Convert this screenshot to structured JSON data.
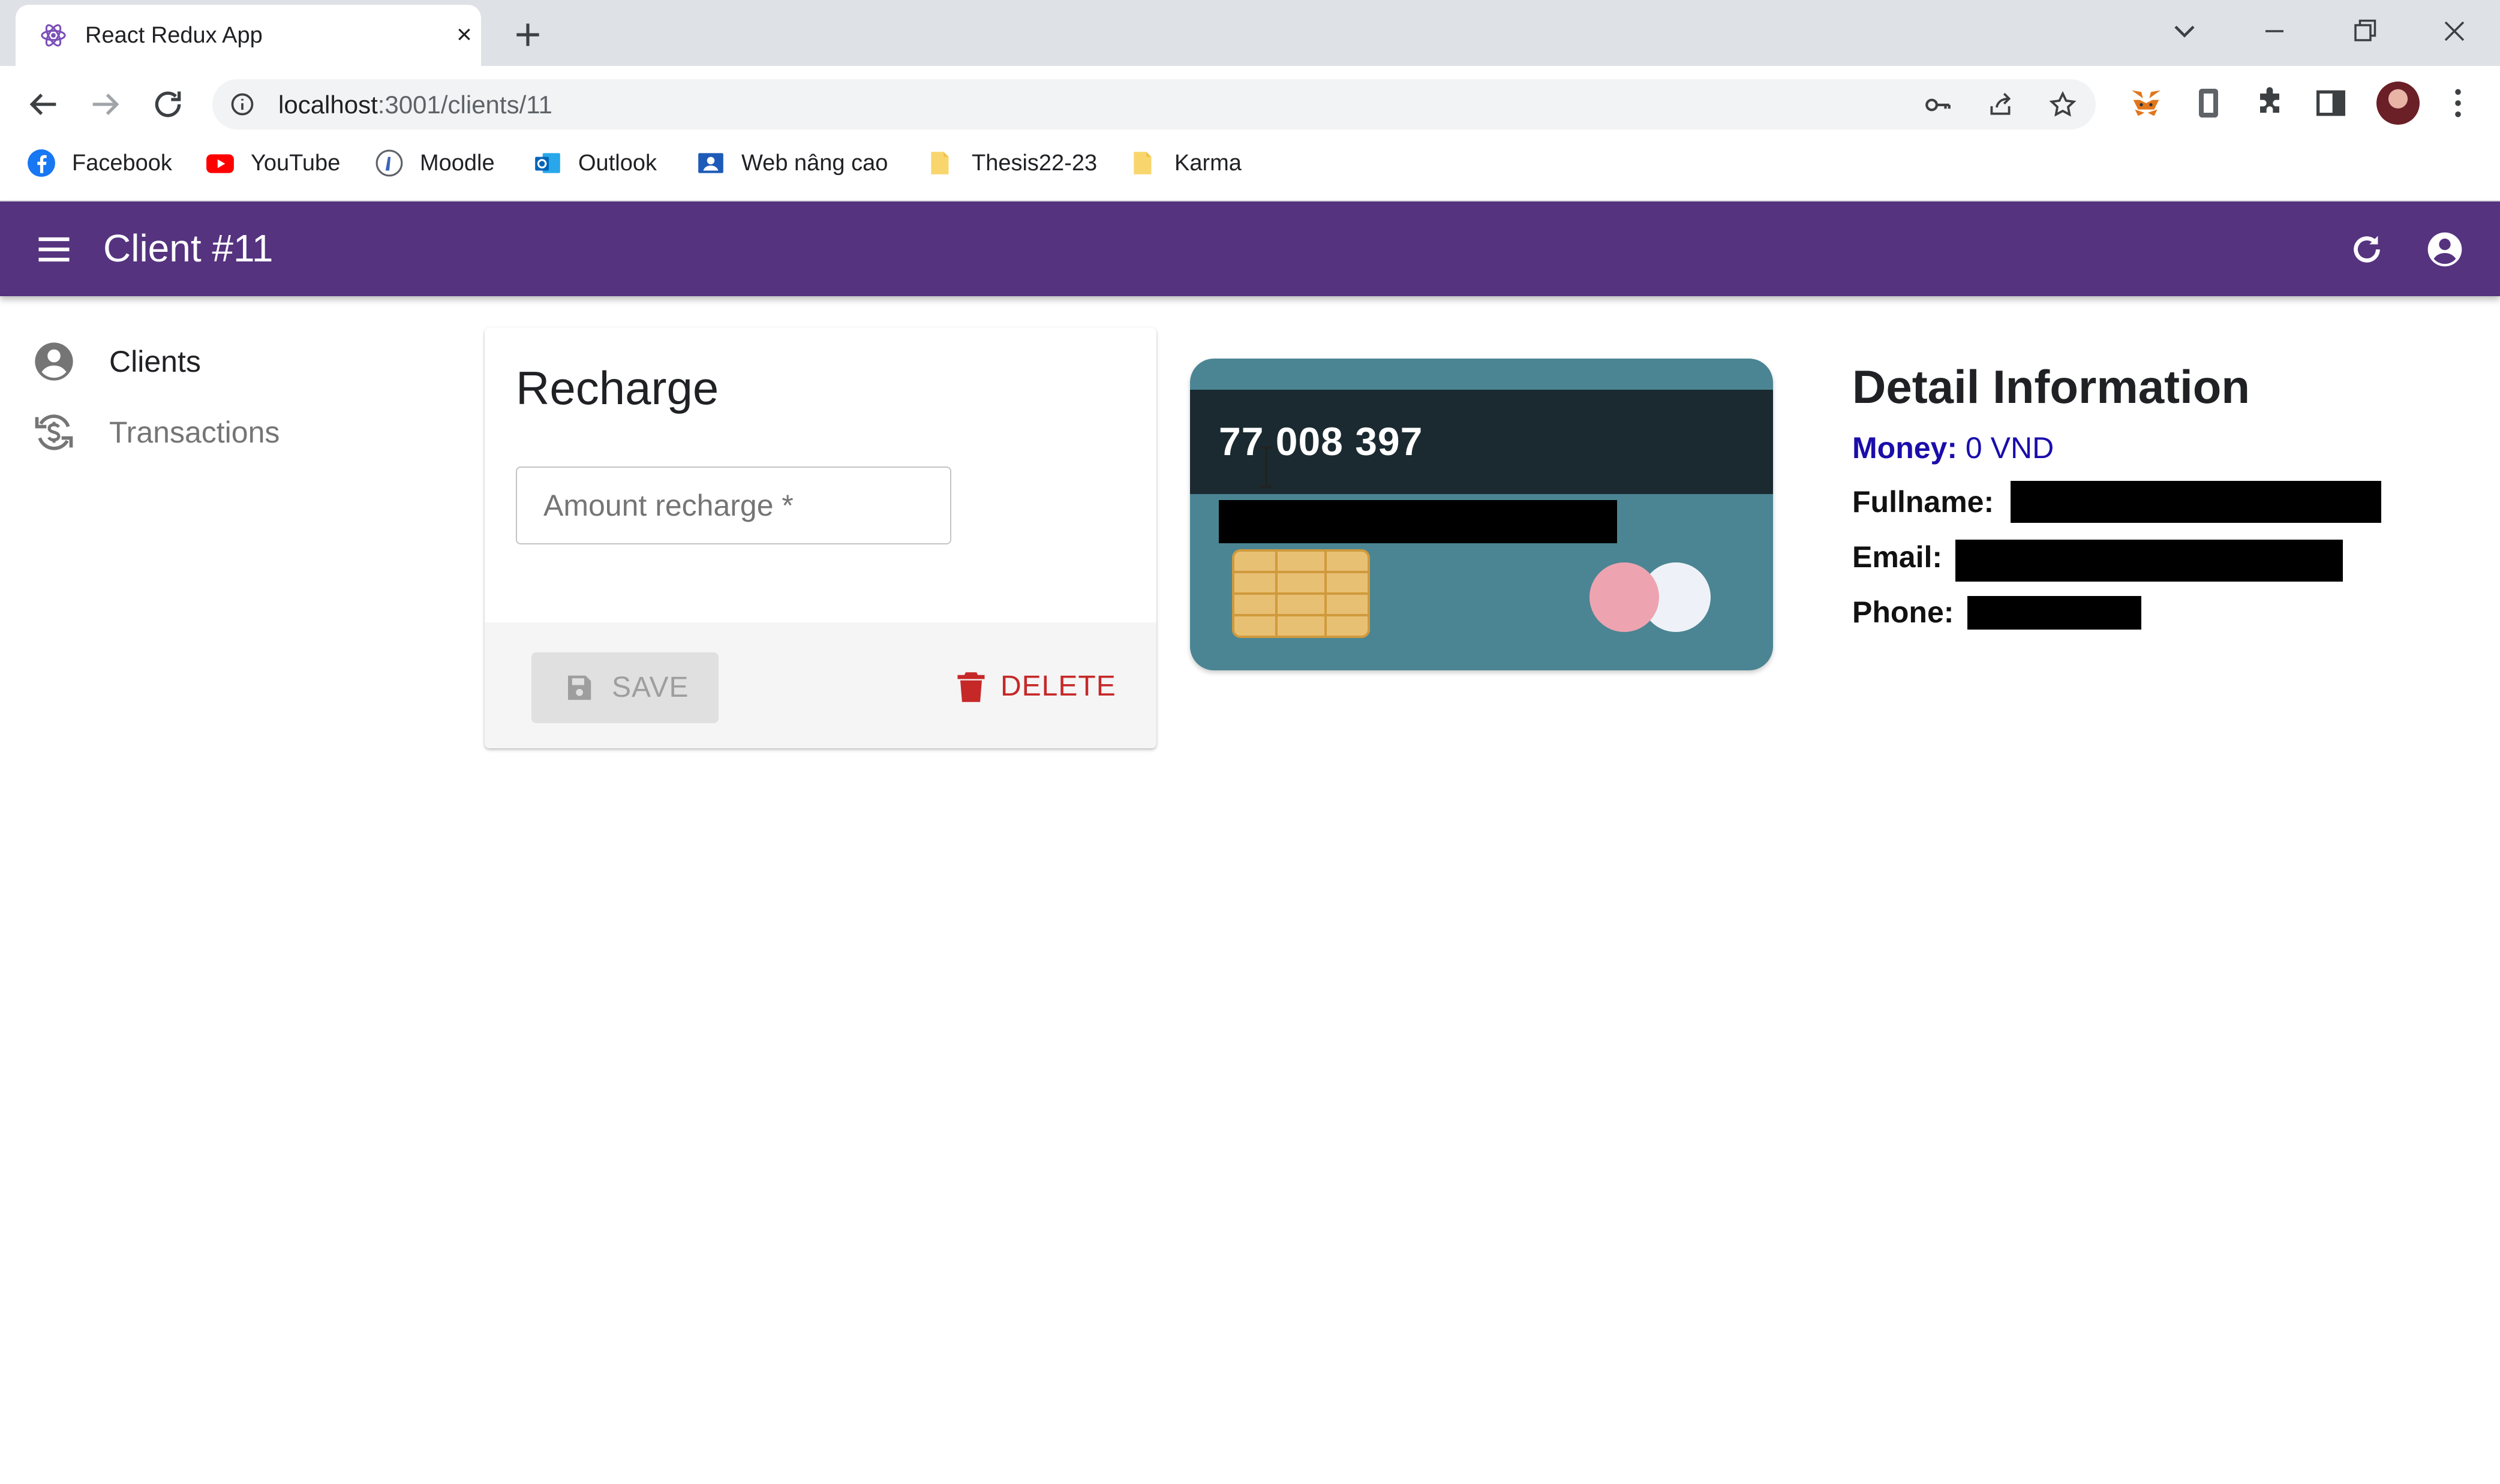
{
  "browser": {
    "tab_title": "React Redux App",
    "tab_close": "×",
    "url_host": "localhost",
    "url_rest": ":3001/clients/11",
    "bookmarks": [
      {
        "label": "Facebook",
        "icon": "facebook-icon"
      },
      {
        "label": "YouTube",
        "icon": "youtube-icon"
      },
      {
        "label": "Moodle",
        "icon": "moodle-icon"
      },
      {
        "label": "Outlook",
        "icon": "outlook-icon"
      },
      {
        "label": "Web nâng cao",
        "icon": "classroom-icon"
      },
      {
        "label": "Thesis22-23",
        "icon": "folder-icon"
      },
      {
        "label": "Karma",
        "icon": "folder-icon"
      }
    ]
  },
  "appbar": {
    "title": "Client #11",
    "color": "#55337f"
  },
  "sidebar": {
    "items": [
      {
        "label": "Clients",
        "icon": "account-circle-icon",
        "color": "#202124"
      },
      {
        "label": "Transactions",
        "icon": "currency-exchange-icon",
        "color": "#757575"
      }
    ]
  },
  "recharge": {
    "title": "Recharge",
    "amount_placeholder": "Amount recharge *",
    "amount_value": "",
    "save_label": "SAVE",
    "delete_label": "DELETE"
  },
  "credit_card": {
    "number": "77 008 397",
    "color": "#4b8593"
  },
  "detail": {
    "title": "Detail Information",
    "money_label": "Money:",
    "money_value": "0 VND",
    "fullname_label": "Fullname:",
    "email_label": "Email:",
    "phone_label": "Phone:"
  }
}
